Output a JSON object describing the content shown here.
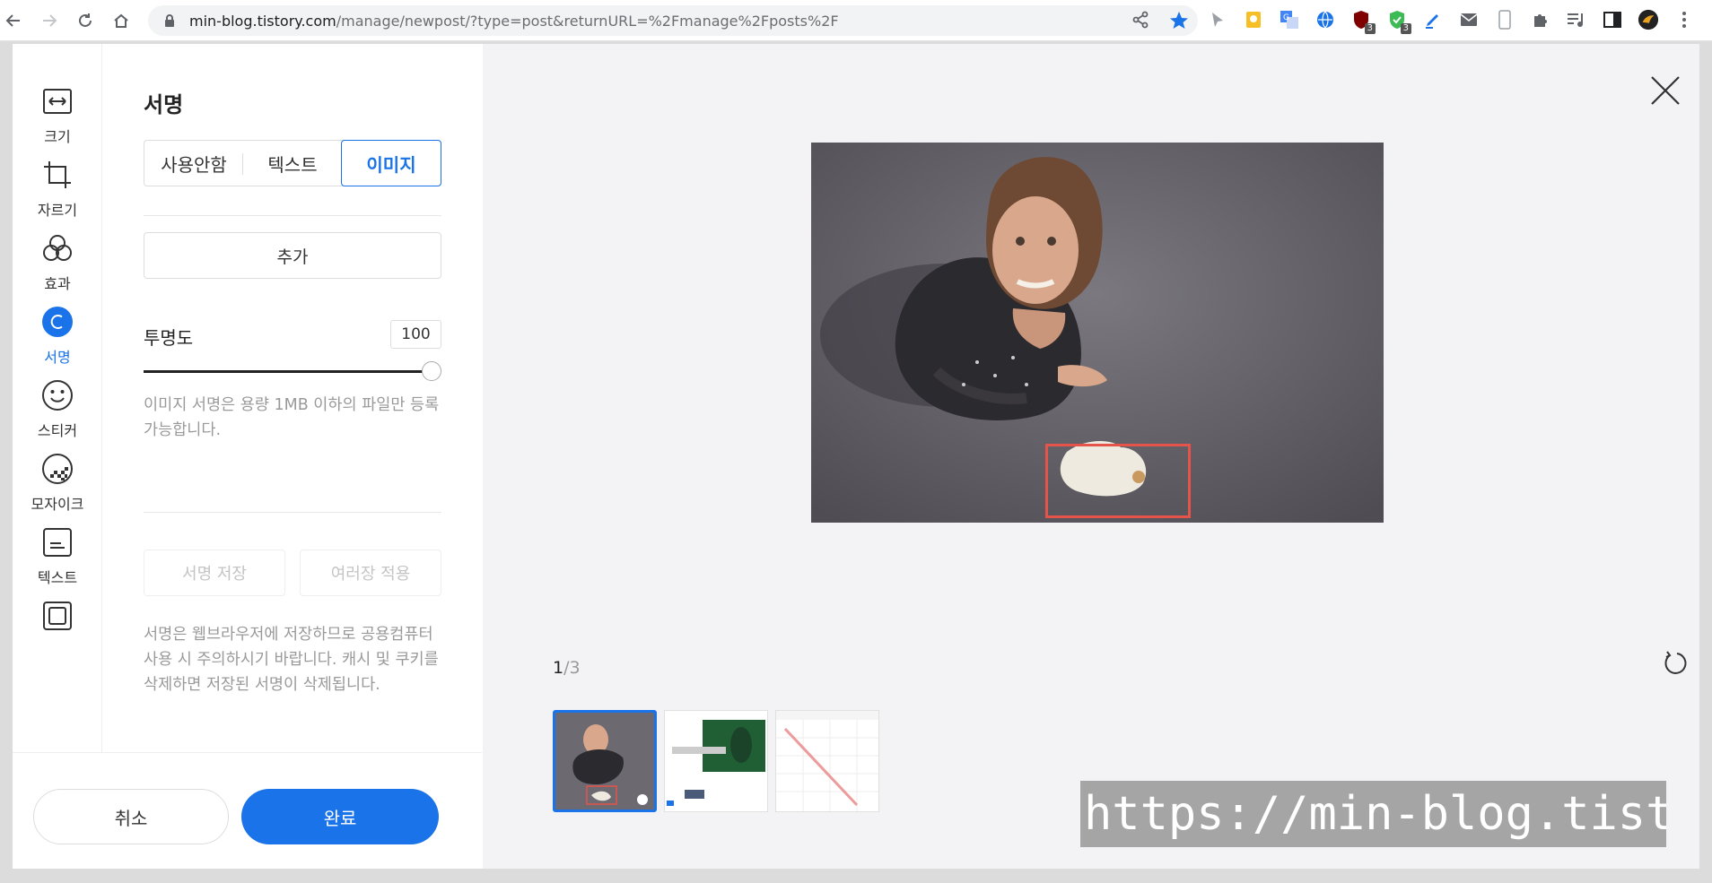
{
  "browser": {
    "url_host": "min-blog.tistory.com",
    "url_path": "/manage/newpost/?type=post&returnURL=%2Fmanage%2Fposts%2F",
    "badges": {
      "ext4": "3",
      "ext5": "3"
    }
  },
  "toolrail": {
    "items": [
      {
        "label": "크기",
        "icon": "resize-icon"
      },
      {
        "label": "자르기",
        "icon": "crop-icon"
      },
      {
        "label": "효과",
        "icon": "effects-icon"
      },
      {
        "label": "서명",
        "icon": "signature-icon",
        "active": true
      },
      {
        "label": "스티커",
        "icon": "sticker-icon"
      },
      {
        "label": "모자이크",
        "icon": "mosaic-icon"
      },
      {
        "label": "텍스트",
        "icon": "text-icon"
      },
      {
        "label": "",
        "icon": "frame-icon"
      }
    ]
  },
  "panel": {
    "title": "서명",
    "tabs": [
      "사용안함",
      "텍스트",
      "이미지"
    ],
    "selected_tab": "이미지",
    "add_label": "추가",
    "opacity_label": "투명도",
    "opacity_value": "100",
    "opacity_fraction": 1.0,
    "size_note": "이미지 서명은 용량 1MB 이하의 파일만 등록 가능합니다.",
    "save_signature_label": "서명 저장",
    "apply_multiple_label": "여러장 적용",
    "storage_note": "서명은 웹브라우저에 저장하므로 공용컴퓨터 사용 시 주의하시기 바랍니다. 캐시 및 쿠키를 삭제하면 저장된 서명이 삭제됩니다."
  },
  "footer": {
    "cancel_label": "취소",
    "done_label": "완료"
  },
  "stage": {
    "page_current": "1",
    "page_total": "/3",
    "watermark_text": "https://min-blog.tistory.com"
  },
  "colors": {
    "accent": "#1a73e8",
    "highlight_box": "#e5534b"
  }
}
